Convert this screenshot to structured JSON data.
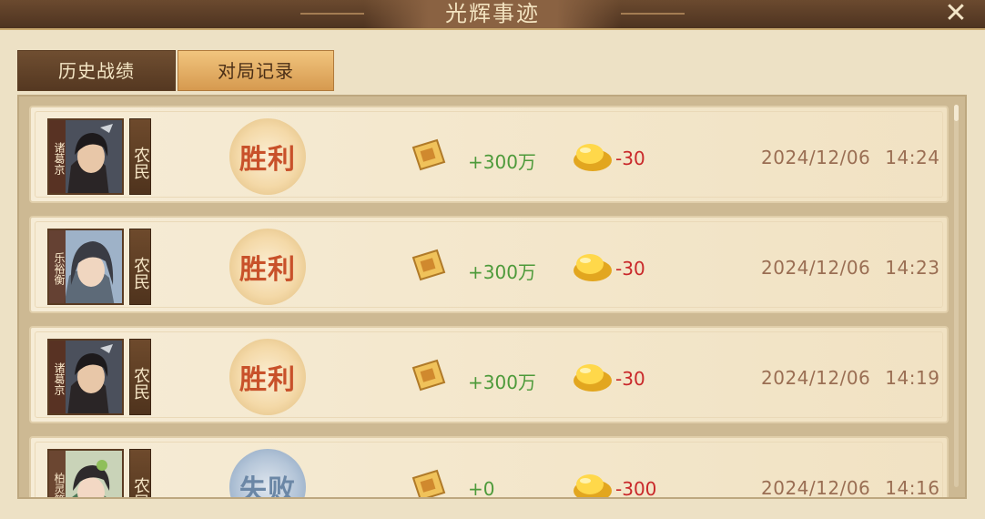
{
  "window": {
    "title": "光辉事迹",
    "close_label": "✕"
  },
  "tabs": [
    {
      "label": "历史战绩",
      "active": false
    },
    {
      "label": "对局记录",
      "active": true
    }
  ],
  "records": [
    {
      "hero_name": "诸葛京",
      "role": "农民",
      "result": "胜利",
      "outcome": "win",
      "coin_change": "+300万",
      "ingot_change": "-30",
      "date": "2024/12/06",
      "time": "14:24"
    },
    {
      "hero_name": "乐裕衡",
      "role": "农民",
      "result": "胜利",
      "outcome": "win",
      "coin_change": "+300万",
      "ingot_change": "-30",
      "date": "2024/12/06",
      "time": "14:23"
    },
    {
      "hero_name": "诸葛京",
      "role": "农民",
      "result": "胜利",
      "outcome": "win",
      "coin_change": "+300万",
      "ingot_change": "-30",
      "date": "2024/12/06",
      "time": "14:19"
    },
    {
      "hero_name": "柏灵筠",
      "role": "农民",
      "result": "失败",
      "outcome": "lose",
      "coin_change": "+0",
      "ingot_change": "-300",
      "date": "2024/12/06",
      "time": "14:16"
    }
  ],
  "icons": {
    "coin_scroll": "gold-scroll-icon",
    "ingot": "gold-ingot-icon",
    "close": "close-icon"
  },
  "colors": {
    "win": "#c8512a",
    "lose": "#6b87a6",
    "gain": "#4d9a3a",
    "loss": "#c9282a"
  }
}
